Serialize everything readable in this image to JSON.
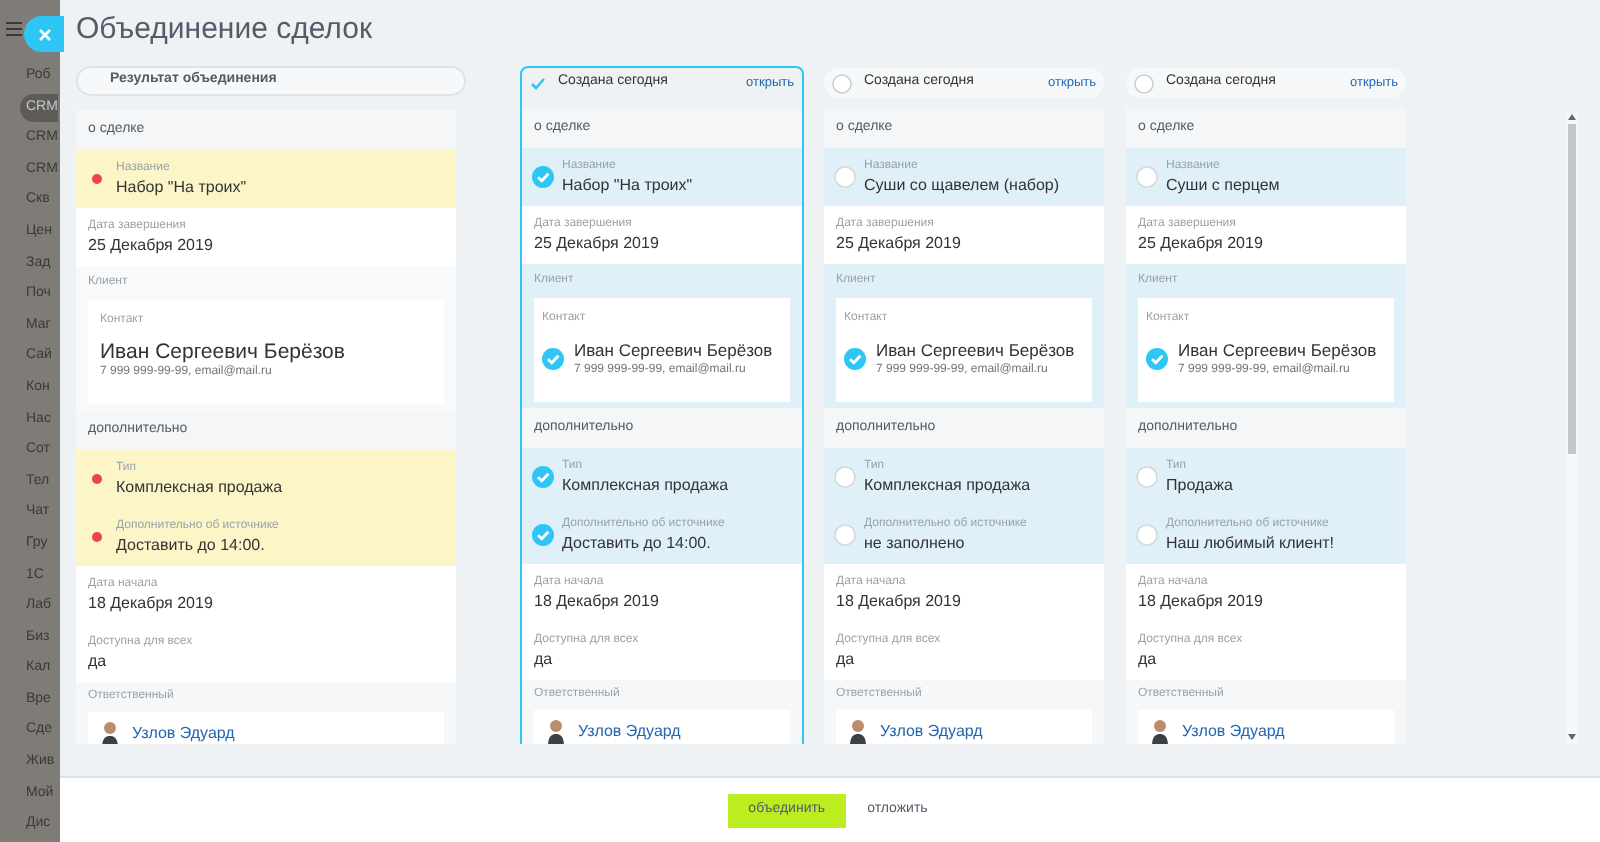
{
  "sidebar": {
    "items": [
      {
        "label": "Роб",
        "selected": false
      },
      {
        "label": "CRM",
        "selected": true
      },
      {
        "label": "CRM",
        "selected": false
      },
      {
        "label": "CRM",
        "selected": false
      },
      {
        "label": "Скв",
        "selected": false
      },
      {
        "label": "Цен",
        "selected": false
      },
      {
        "label": "Зад",
        "selected": false
      },
      {
        "label": "Поч",
        "selected": false
      },
      {
        "label": "Маг",
        "selected": false
      },
      {
        "label": "Сай",
        "selected": false
      },
      {
        "label": "Кон",
        "selected": false
      },
      {
        "label": "Нас",
        "selected": false
      },
      {
        "label": "Сот",
        "selected": false
      },
      {
        "label": "Тел",
        "selected": false
      },
      {
        "label": "Чат",
        "selected": false
      },
      {
        "label": "Гру",
        "selected": false
      },
      {
        "label": "1С",
        "selected": false
      },
      {
        "label": "Лаб",
        "selected": false
      },
      {
        "label": "Биз",
        "selected": false
      },
      {
        "label": "Кал",
        "selected": false
      },
      {
        "label": "Вре",
        "selected": false
      },
      {
        "label": "Сде",
        "selected": false
      },
      {
        "label": "Жив",
        "selected": false
      },
      {
        "label": "Мой",
        "selected": false
      },
      {
        "label": "Дис",
        "selected": false
      }
    ]
  },
  "dialog": {
    "title": "Объединение сделок",
    "result": {
      "header": "Результат объединения",
      "sections": [
        {
          "title": "о сделке",
          "rows": [
            {
              "kind": "choice",
              "items": [
                {
                  "label": "Название",
                  "value": "Набор \"На троих\"",
                  "conflict": true
                }
              ]
            },
            {
              "kind": "plain",
              "label": "Дата завершения",
              "value": "25 Декабря 2019"
            },
            {
              "kind": "client",
              "label": "Клиент",
              "contact_label": "Контакт",
              "name": "Иван Сергеевич Берёзов",
              "details": "7 999 999-99-99, email@mail.ru"
            }
          ]
        },
        {
          "title": "дополнительно",
          "rows": [
            {
              "kind": "choice",
              "items": [
                {
                  "label": "Тип",
                  "value": "Комплексная продажа",
                  "conflict": true
                },
                {
                  "label": "Дополнительно об источнике",
                  "value": "Доставить до 14:00.",
                  "conflict": true
                }
              ]
            },
            {
              "kind": "plain",
              "label": "Дата начала",
              "value": "18 Декабря 2019"
            },
            {
              "kind": "plain",
              "label": "Доступна для всех",
              "value": "да"
            },
            {
              "kind": "user",
              "label": "Ответственный",
              "name": "Узлов Эдуард"
            }
          ]
        }
      ]
    },
    "candidates": [
      {
        "selected": true,
        "label": "Создана сегодня",
        "link": "открыть",
        "sections": [
          {
            "title": "о сделке",
            "rows": [
              {
                "kind": "choice",
                "items": [
                  {
                    "label": "Название",
                    "value": "Набор \"На троих\"",
                    "selected": true
                  }
                ]
              },
              {
                "kind": "plain",
                "label": "Дата завершения",
                "value": "25 Декабря 2019"
              },
              {
                "kind": "client",
                "label": "Клиент",
                "contact_label": "Контакт",
                "name": "Иван Сергеевич Берёзов",
                "details": "7 999 999-99-99, email@mail.ru",
                "selected": true
              }
            ]
          },
          {
            "title": "дополнительно",
            "rows": [
              {
                "kind": "choice",
                "items": [
                  {
                    "label": "Тип",
                    "value": "Комплексная продажа",
                    "selected": true
                  },
                  {
                    "label": "Дополнительно об источнике",
                    "value": "Доставить до 14:00.",
                    "selected": true
                  }
                ]
              },
              {
                "kind": "plain",
                "label": "Дата начала",
                "value": "18 Декабря 2019"
              },
              {
                "kind": "plain",
                "label": "Доступна для всех",
                "value": "да"
              },
              {
                "kind": "user",
                "label": "Ответственный",
                "name": "Узлов Эдуард"
              }
            ]
          }
        ]
      },
      {
        "selected": false,
        "label": "Создана сегодня",
        "link": "открыть",
        "sections": [
          {
            "title": "о сделке",
            "rows": [
              {
                "kind": "choice",
                "items": [
                  {
                    "label": "Название",
                    "value": "Суши со щавелем (набор)",
                    "selected": false
                  }
                ]
              },
              {
                "kind": "plain",
                "label": "Дата завершения",
                "value": "25 Декабря 2019"
              },
              {
                "kind": "client",
                "label": "Клиент",
                "contact_label": "Контакт",
                "name": "Иван Сергеевич Берёзов",
                "details": "7 999 999-99-99, email@mail.ru",
                "selected": true
              }
            ]
          },
          {
            "title": "дополнительно",
            "rows": [
              {
                "kind": "choice",
                "items": [
                  {
                    "label": "Тип",
                    "value": "Комплексная продажа",
                    "selected": false
                  },
                  {
                    "label": "Дополнительно об источнике",
                    "value": "не заполнено",
                    "selected": false
                  }
                ]
              },
              {
                "kind": "plain",
                "label": "Дата начала",
                "value": "18 Декабря 2019"
              },
              {
                "kind": "plain",
                "label": "Доступна для всех",
                "value": "да"
              },
              {
                "kind": "user",
                "label": "Ответственный",
                "name": "Узлов Эдуард"
              }
            ]
          }
        ]
      },
      {
        "selected": false,
        "label": "Создана сегодня",
        "link": "открыть",
        "sections": [
          {
            "title": "о сделке",
            "rows": [
              {
                "kind": "choice",
                "items": [
                  {
                    "label": "Название",
                    "value": "Суши с перцем",
                    "selected": false
                  }
                ]
              },
              {
                "kind": "plain",
                "label": "Дата завершения",
                "value": "25 Декабря 2019"
              },
              {
                "kind": "client",
                "label": "Клиент",
                "contact_label": "Контакт",
                "name": "Иван Сергеевич Берёзов",
                "details": "7 999 999-99-99, email@mail.ru",
                "selected": true
              }
            ]
          },
          {
            "title": "дополнительно",
            "rows": [
              {
                "kind": "choice",
                "items": [
                  {
                    "label": "Тип",
                    "value": "Продажа",
                    "selected": false
                  },
                  {
                    "label": "Дополнительно об источнике",
                    "value": "Наш любимый клиент!",
                    "selected": false
                  }
                ]
              },
              {
                "kind": "plain",
                "label": "Дата начала",
                "value": "18 Декабря 2019"
              },
              {
                "kind": "plain",
                "label": "Доступна для всех",
                "value": "да"
              },
              {
                "kind": "user",
                "label": "Ответственный",
                "name": "Узлов Эдуард"
              }
            ]
          }
        ]
      }
    ],
    "buttons": [
      {
        "label": "объединить",
        "kind": "primary"
      },
      {
        "label": "отложить",
        "kind": "link"
      }
    ]
  }
}
